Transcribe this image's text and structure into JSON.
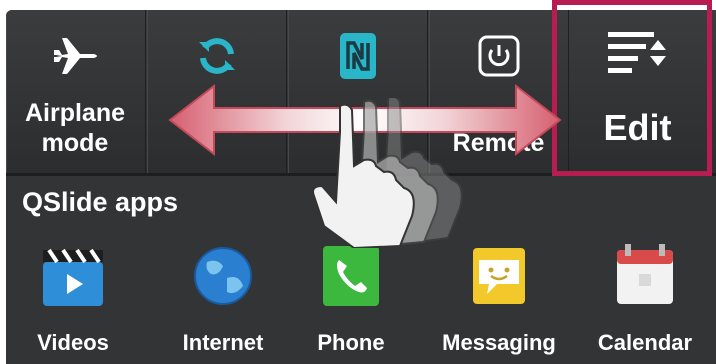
{
  "quick_settings": {
    "tiles": [
      {
        "label": "Airplane mode",
        "icon": "airplane-icon"
      },
      {
        "label": "",
        "icon": "sync-icon"
      },
      {
        "label": "",
        "icon": "nfc-icon"
      },
      {
        "label": "Remote",
        "icon": "power-icon"
      },
      {
        "label": "Edit",
        "icon": "edit-sort-icon"
      }
    ]
  },
  "qslide": {
    "title": "QSlide apps",
    "apps": [
      {
        "label": "Videos",
        "icon": "videos-icon"
      },
      {
        "label": "Internet",
        "icon": "globe-icon"
      },
      {
        "label": "Phone",
        "icon": "phone-icon"
      },
      {
        "label": "Messaging",
        "icon": "messaging-icon"
      },
      {
        "label": "Calendar",
        "icon": "calendar-icon"
      }
    ]
  },
  "colors": {
    "panel": "#333436",
    "highlight": "#b81d52",
    "accent_teal": "#29b6c9",
    "swipe_arrow": "#d0606b"
  },
  "gesture": {
    "icon": "swipe-hand-icon",
    "arrow": "double-arrow-icon"
  }
}
